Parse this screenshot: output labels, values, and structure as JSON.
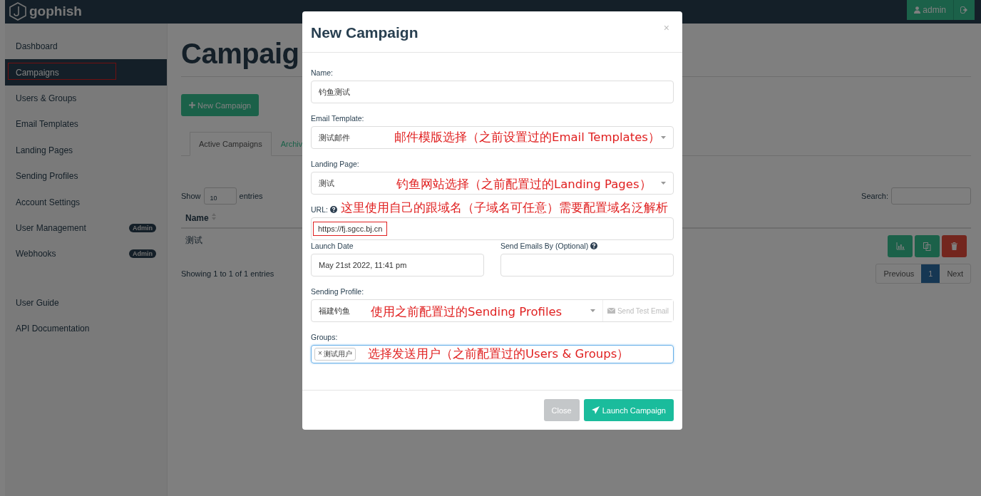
{
  "app": {
    "logo": "gophish",
    "user": "admin"
  },
  "sidebar": {
    "items": [
      {
        "label": "Dashboard",
        "selected": false,
        "highlighted": false
      },
      {
        "label": "Campaigns",
        "selected": true,
        "highlighted": true
      },
      {
        "label": "Users & Groups",
        "selected": false,
        "highlighted": false
      },
      {
        "label": "Email Templates",
        "selected": false,
        "highlighted": false
      },
      {
        "label": "Landing Pages",
        "selected": false,
        "highlighted": false
      },
      {
        "label": "Sending Profiles",
        "selected": false,
        "highlighted": false
      },
      {
        "label": "Account Settings",
        "selected": false,
        "highlighted": false
      },
      {
        "label": "User Management",
        "selected": false,
        "highlighted": false,
        "badge": "Admin"
      },
      {
        "label": "Webhooks",
        "selected": false,
        "highlighted": false,
        "badge": "Admin"
      }
    ],
    "bottom_items": [
      {
        "label": "User Guide"
      },
      {
        "label": "API Documentation"
      }
    ]
  },
  "page": {
    "title": "Campaig",
    "new_button": "New Campaign",
    "tabs": [
      {
        "label": "Active Campaigns",
        "selected": true
      },
      {
        "label": "Archiv",
        "selected": false
      }
    ],
    "show": {
      "before": "Show",
      "value": "10",
      "after": "entries"
    },
    "search_label": "Search:",
    "table": {
      "columns": [
        "Name"
      ],
      "rows": [
        {
          "name": "测试"
        }
      ]
    },
    "info": "Showing 1 to 1 of 1 entries",
    "pagination": {
      "previous": "Previous",
      "pages": [
        {
          "label": "1",
          "selected": true
        }
      ],
      "next": "Next"
    }
  },
  "modal": {
    "title": "New Campaign",
    "close": "×",
    "fields": [
      {
        "kind": "text",
        "label": "Name:",
        "value": "钓鱼测试"
      },
      {
        "kind": "select",
        "label": "Email Template:",
        "value": "测试邮件",
        "annotation": "邮件模版选择（之前设置过的Email Templates）"
      },
      {
        "kind": "select",
        "label": "Landing Page:",
        "value": "测试",
        "annotation": "钓鱼网站选择（之前配置过的Landing Pages）"
      },
      {
        "kind": "text",
        "label": "URL:",
        "help": true,
        "value": "https://fj.sgcc.bj.cn",
        "highlighted": true,
        "annotation": "这里使用自己的跟域名（子域名可任意）需要配置域名泛解析"
      },
      {
        "kind": "pair",
        "items": [
          {
            "label": "Launch Date",
            "value": "May 21st 2022, 11:41 pm"
          },
          {
            "label": "Send Emails By (Optional)",
            "help": true
          }
        ]
      },
      {
        "kind": "select_button",
        "label": "Sending Profile:",
        "value": "福建钓鱼",
        "button": "Send Test Email",
        "annotation": "使用之前配置过的Sending Profiles"
      },
      {
        "kind": "tags",
        "label": "Groups:",
        "focused": true,
        "tags": [
          {
            "label": "测试用户",
            "remove": "×"
          }
        ],
        "annotation": "选择发送用户（之前配置过的Users & Groups）"
      }
    ],
    "buttons": {
      "close": "Close",
      "launch": "Launch Campaign"
    }
  }
}
